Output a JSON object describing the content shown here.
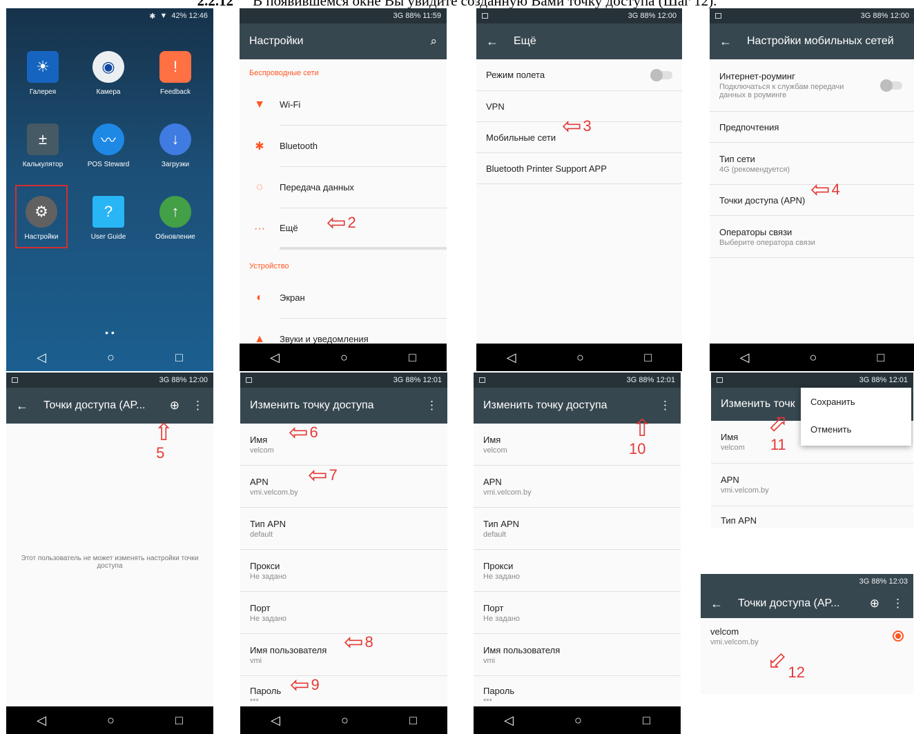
{
  "doc_heading": {
    "number": "2.2.12",
    "text": "В появившемся окне Вы увидите созданную Вами точку доступа (Шаг 12)."
  },
  "home": {
    "status": "42%  12:46",
    "apps": [
      "Галерея",
      "Камера",
      "Feedback",
      "Калькулятор",
      "POS Steward",
      "Загрузки",
      "Настройки",
      "User Guide",
      "Обновление"
    ]
  },
  "settings": {
    "status": "3G   88%  11:59",
    "title": "Настройки",
    "section_wireless": "Беспроводные сети",
    "items": [
      "Wi-Fi",
      "Bluetooth",
      "Передача данных",
      "Ещё"
    ],
    "section_device": "Устройство",
    "device_items": [
      "Экран",
      "Звуки и уведомления"
    ]
  },
  "more": {
    "status": "3G   88%  12:00",
    "title": "Ещё",
    "items": [
      "Режим полета",
      "VPN",
      "Мобильные сети",
      "Bluetooth Printer Support APP"
    ]
  },
  "mobile": {
    "status": "3G   88%  12:00",
    "title": "Настройки мобильных сетей",
    "roaming_title": "Интернет-роуминг",
    "roaming_sub": "Подключаться к службам передачи данных в роуминге",
    "prefs": "Предпочтения",
    "net_type": "Тип сети",
    "net_type_sub": "4G (рекомендуется)",
    "apn": "Точки доступа (APN)",
    "operators": "Операторы связи",
    "operators_sub": "Выберите оператора связи"
  },
  "apn_empty": {
    "status": "3G   88%  12:00",
    "title": "Точки доступа (AP...",
    "message": "Этот пользователь не может изменять настройки точки доступа"
  },
  "edit": {
    "status": "3G   88%  12:01",
    "title": "Изменить точку доступа",
    "fields": [
      {
        "label": "Имя",
        "value": "velcom"
      },
      {
        "label": "APN",
        "value": "vmi.velcom.by"
      },
      {
        "label": "Тип APN",
        "value": "default"
      },
      {
        "label": "Прокси",
        "value": "Не задано"
      },
      {
        "label": "Порт",
        "value": "Не задано"
      },
      {
        "label": "Имя пользователя",
        "value": "vmi"
      },
      {
        "label": "Пароль",
        "value": "***"
      }
    ]
  },
  "edit_menu": {
    "status": "3G   88%  12:01",
    "title": "Изменить точк",
    "save": "Сохранить",
    "cancel": "Отменить"
  },
  "apn_list": {
    "status": "3G   88%  12:03",
    "title": "Точки доступа (AP...",
    "name": "velcom",
    "apn": "vmi.velcom.by"
  },
  "steps": [
    "2",
    "3",
    "4",
    "5",
    "6",
    "7",
    "8",
    "9",
    "10",
    "11",
    "12"
  ],
  "nav": {
    "back": "◁",
    "home": "○",
    "recent": "□"
  }
}
